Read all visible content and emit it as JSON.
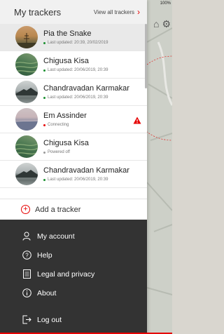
{
  "status_bar": {
    "text": "100%"
  },
  "drawer": {
    "title": "My trackers",
    "view_all_label": "View all trackers"
  },
  "trackers": [
    {
      "name": "Pia the Snake",
      "status": "Last updated: 20:39, 20/02/2019",
      "status_color": "#1a8f2f",
      "avatar": "sunset",
      "selected": true,
      "alert": false
    },
    {
      "name": "Chigusa Kisa",
      "status": "Last updated: 20/06/2019, 20:39",
      "status_color": "#1a8f2f",
      "avatar": "field",
      "selected": false,
      "alert": false
    },
    {
      "name": "Chandravadan Karmakar",
      "status": "Last updated: 20/06/2019, 20:39",
      "status_color": "#1a8f2f",
      "avatar": "mountain",
      "selected": false,
      "alert": false
    },
    {
      "name": "Em Assinder",
      "status": "Connecting",
      "status_color": "#e60000",
      "avatar": "lake",
      "selected": false,
      "alert": true
    },
    {
      "name": "Chigusa Kisa",
      "status": "Powered off",
      "status_color": "#9a9a9a",
      "avatar": "field",
      "selected": false,
      "alert": false
    },
    {
      "name": "Chandravadan Karmakar",
      "status": "Last updated: 20/06/2019, 20:39",
      "status_color": "#1a8f2f",
      "avatar": "mountain",
      "selected": false,
      "alert": false
    }
  ],
  "add_tracker": {
    "label": "Add a tracker",
    "icon": "plus-circle-icon"
  },
  "menu": [
    {
      "label": "My account",
      "icon": "person-icon"
    },
    {
      "label": "Help",
      "icon": "question-circle-icon"
    },
    {
      "label": "Legal and privacy",
      "icon": "document-icon"
    },
    {
      "label": "About",
      "icon": "info-circle-icon"
    },
    {
      "label": "Log out",
      "icon": "logout-icon"
    }
  ],
  "colors": {
    "accent": "#e60000",
    "menu_bg": "#333333",
    "online": "#1a8f2f"
  }
}
